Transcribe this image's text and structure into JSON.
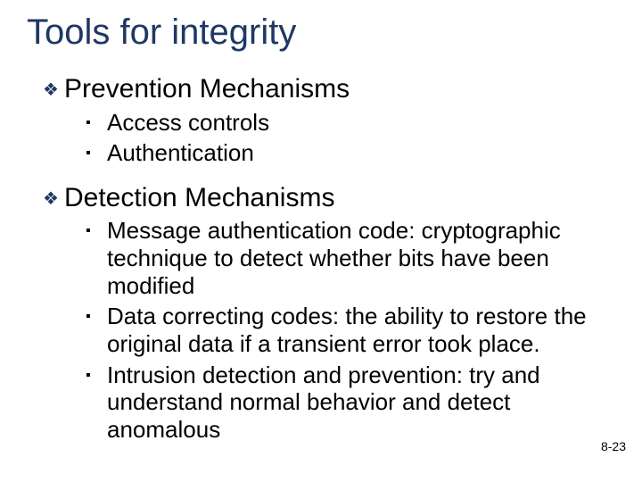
{
  "title": "Tools for integrity",
  "sections": [
    {
      "heading": "Prevention Mechanisms",
      "items": [
        "Access controls",
        "Authentication"
      ]
    },
    {
      "heading": "Detection Mechanisms",
      "items": [
        "Message authentication code: cryptographic technique to detect whether bits have been modified",
        "Data correcting codes: the ability to restore the original data if a transient error took place.",
        "Intrusion detection and prevention: try and understand normal behavior and detect anomalous"
      ]
    }
  ],
  "footer": "8-23",
  "glyphs": {
    "diamond": "❖",
    "square": "▪"
  }
}
